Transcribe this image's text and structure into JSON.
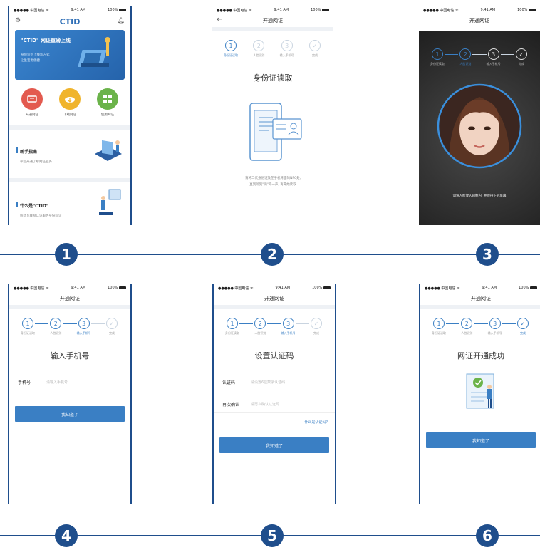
{
  "timeline_numbers": [
    "1",
    "2",
    "3",
    "4",
    "5",
    "6"
  ],
  "status": {
    "carrier": "●●●●● 中国电信 ᯤ",
    "time": "9:41 AM",
    "battery": "100%"
  },
  "screen1": {
    "brand": "CTID",
    "banner_title": "\"CTID\" 网证重磅上线",
    "banner_sub1": "身份识别上线新方式",
    "banner_sub2": "让生活更便捷",
    "quick_actions": [
      "开通网证",
      "下载网证",
      "使用网证"
    ],
    "section1_title": "新手指南",
    "section1_sub": "带您开通了解网证业务",
    "section2_title": "什么是\"CTID\"",
    "section2_sub": "移动互联网认证服务身份标识"
  },
  "nav_title": "开通网证",
  "steps": [
    "身份证读取",
    "人脸识别",
    "输入手机号",
    "完成"
  ],
  "screen2": {
    "heading": "身份证读取",
    "hint1": "请将二代身份证放在手机背面的NFC处,",
    "hint2": "直到听到\"滴\"的一声, 再开始读取"
  },
  "screen3": {
    "hint": "请将人脸放入圆框内, 并保持正对屏幕"
  },
  "screen4": {
    "heading": "输入手机号",
    "field_label": "手机号",
    "field_placeholder": "请输入手机号",
    "button": "我知道了"
  },
  "screen5": {
    "heading": "设置认证码",
    "field1_label": "认证码",
    "field1_placeholder": "请设置6位数字认证码",
    "field2_label": "再次确认",
    "field2_placeholder": "请再次确认认证码",
    "link": "什么是认证码?",
    "button": "我知道了"
  },
  "screen6": {
    "heading": "网证开通成功",
    "button": "我知道了"
  },
  "colors": {
    "accent": "#3a7fc4",
    "timeline": "#1f4e8c"
  }
}
